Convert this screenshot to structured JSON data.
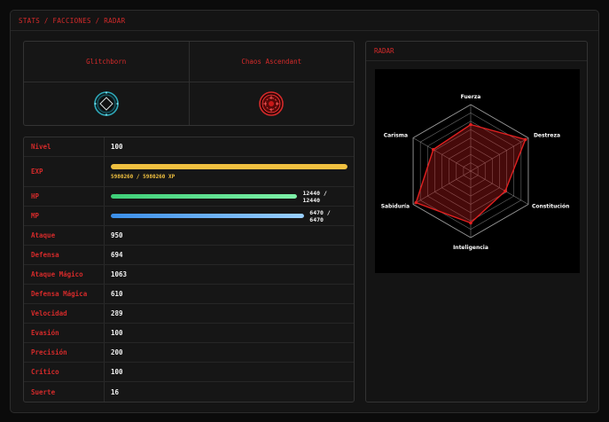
{
  "breadcrumb": "STATS / FACCIONES / RADAR",
  "factions": [
    {
      "name": "Glitchborn",
      "emblem": "glitchborn-emblem-icon",
      "color": "#2fa8b8"
    },
    {
      "name": "Chaos Ascendant",
      "emblem": "chaos-emblem-icon",
      "color": "#d42a2a"
    }
  ],
  "stats": {
    "nivel": {
      "label": "Nivel",
      "value": "100"
    },
    "exp": {
      "label": "EXP",
      "text": "5980260 / 5980260 XP",
      "fraction": 1.0,
      "color": "#f0c040"
    },
    "hp": {
      "label": "HP",
      "text": "12440 / 12440",
      "fraction": 1.0,
      "color": "#4cd884"
    },
    "mp": {
      "label": "MP",
      "text": "6470 / 6470",
      "fraction": 1.0,
      "color": "#5aa8f0"
    },
    "rows": [
      {
        "label": "Ataque",
        "value": "950"
      },
      {
        "label": "Defensa",
        "value": "694"
      },
      {
        "label": "Ataque Mágico",
        "value": "1063"
      },
      {
        "label": "Defensa Mágica",
        "value": "610"
      },
      {
        "label": "Velocidad",
        "value": "289"
      },
      {
        "label": "Evasión",
        "value": "100"
      },
      {
        "label": "Precisión",
        "value": "200"
      },
      {
        "label": "Crítico",
        "value": "100"
      },
      {
        "label": "Suerte",
        "value": "16"
      }
    ]
  },
  "radar": {
    "title": "RADAR",
    "axes": [
      "Fuerza",
      "Destreza",
      "Constitución",
      "Inteligencia",
      "Sabiduría",
      "Carisma"
    ],
    "values": [
      0.7,
      0.95,
      0.6,
      0.78,
      0.95,
      0.65
    ],
    "color": "#e02020"
  }
}
